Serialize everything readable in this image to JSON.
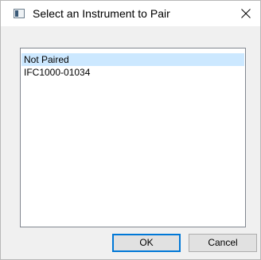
{
  "window": {
    "title": "Select an Instrument to Pair"
  },
  "list": {
    "items": [
      {
        "label": "Not Paired",
        "selected": true
      },
      {
        "label": "IFC1000-01034",
        "selected": false
      }
    ]
  },
  "buttons": {
    "ok_label": "OK",
    "cancel_label": "Cancel"
  },
  "colors": {
    "selection": "#cce8ff",
    "default_button_border": "#0078d7"
  }
}
